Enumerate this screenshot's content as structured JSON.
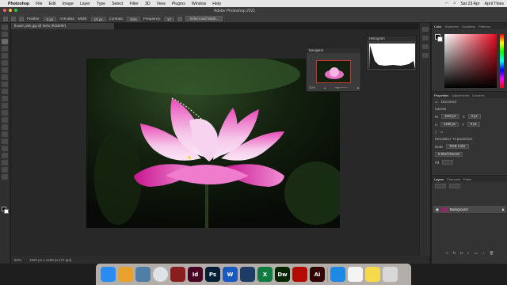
{
  "menubar": {
    "apple": "",
    "app": "Photoshop",
    "items": [
      "File",
      "Edit",
      "Image",
      "Layer",
      "Type",
      "Select",
      "Filter",
      "3D",
      "View",
      "Plugins",
      "Window",
      "Help"
    ],
    "clock": "Sat 23 Apr",
    "user": "April Thies"
  },
  "window": {
    "title": "Adobe Photoshop 2021"
  },
  "options": {
    "feather_label": "Feather:",
    "feather_value": "0 px",
    "antialias": "Anti-alias",
    "style_label": "Width:",
    "width_value": "10 px",
    "contrast_label": "Contrast:",
    "contrast_value": "10%",
    "frequency_label": "Frequency:",
    "frequency_value": "57",
    "select_mask": "Select and Mask..."
  },
  "document": {
    "tab": "flower pink.jpg @ 50% (RGB/8#)",
    "zoom": "50%",
    "doc_info": "1920 px x 1280 px (72 ppi)"
  },
  "navigator": {
    "title": "Navigator",
    "zoom": "50%"
  },
  "histogram": {
    "title": "Histogram"
  },
  "color_panel": {
    "tabs": [
      "Color",
      "Swatches",
      "Gradients",
      "Patterns"
    ]
  },
  "properties": {
    "tabs": [
      "Properties",
      "Adjustments",
      "Libraries"
    ],
    "section": "Document",
    "canvas_label": "Canvas",
    "w_label": "W",
    "w_value": "1920 px",
    "h_label": "H",
    "h_value": "1280 px",
    "x_label": "X",
    "x_value": "0 px",
    "y_label": "Y",
    "y_value": "0 px",
    "resolution": "Resolution: 72 pixels/inch",
    "mode_label": "Mode",
    "mode_value": "RGB Color",
    "depth_value": "8 Bits/Channel",
    "fill_label": "Fill"
  },
  "layers": {
    "tabs": [
      "Layers",
      "Channels",
      "Paths"
    ],
    "layer_name": "Background"
  },
  "dock_apps": [
    {
      "name": "finder",
      "label": "",
      "color": "#2a8bf2"
    },
    {
      "name": "launchpad",
      "label": "",
      "color": "#e8a12b"
    },
    {
      "name": "preview",
      "label": "",
      "color": "#4f7fa6"
    },
    {
      "name": "chrome",
      "label": "",
      "color": "#dfe2e6"
    },
    {
      "name": "photo-booth",
      "label": "",
      "color": "#8a1d1d"
    },
    {
      "name": "indesign",
      "label": "Id",
      "color": "#49021f"
    },
    {
      "name": "photoshop",
      "label": "Ps",
      "color": "#001e36"
    },
    {
      "name": "word",
      "label": "W",
      "color": "#185abd"
    },
    {
      "name": "quicktime",
      "label": "",
      "color": "#1d3c66"
    },
    {
      "name": "excel",
      "label": "X",
      "color": "#107c41"
    },
    {
      "name": "dreamweaver",
      "label": "Dw",
      "color": "#072401"
    },
    {
      "name": "acrobat",
      "label": "",
      "color": "#b30b00"
    },
    {
      "name": "illustrator",
      "label": "Ai",
      "color": "#330000"
    },
    {
      "name": "safari",
      "label": "",
      "color": "#1e88e5"
    },
    {
      "name": "textedit",
      "label": "",
      "color": "#f4f4f4"
    },
    {
      "name": "notes",
      "label": "",
      "color": "#f7d94c"
    },
    {
      "name": "trash",
      "label": "",
      "color": "#d8d8d8"
    }
  ]
}
